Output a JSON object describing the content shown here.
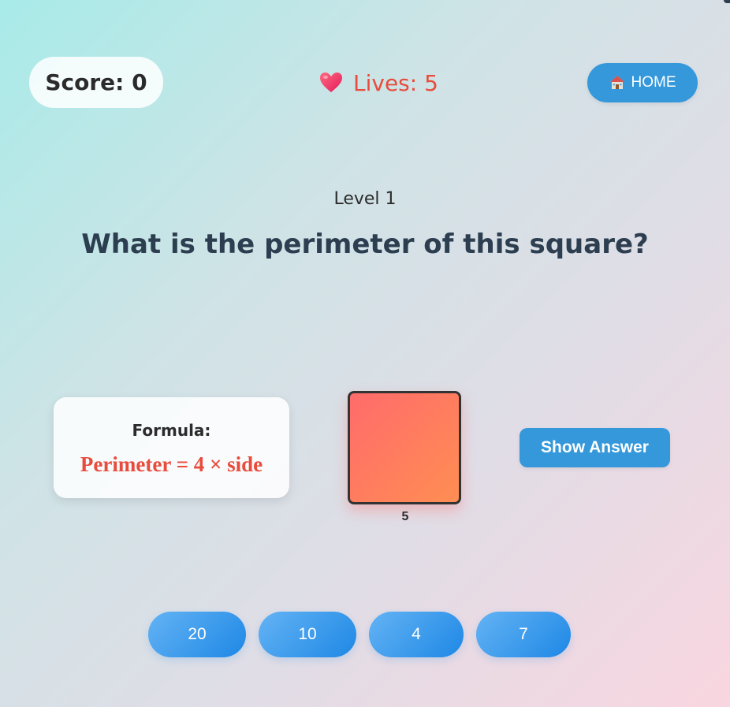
{
  "hud": {
    "score_text": "Score: 0",
    "lives_text": "Lives: 5",
    "home_label": "HOME"
  },
  "level_text": "Level 1",
  "question_text": "What is the perimeter of this square?",
  "formula": {
    "label": "Formula:",
    "text": "Perimeter = 4 × side"
  },
  "shape": {
    "type": "square",
    "side_label": "5",
    "fill_colors": [
      "#ff6b6b",
      "#ff8e53"
    ]
  },
  "show_answer_label": "Show Answer",
  "options": [
    "20",
    "10",
    "4",
    "7"
  ],
  "colors": {
    "accent": "#3498db",
    "lives": "#e74c3c",
    "formula": "#e74c3c",
    "question": "#2c3e50"
  },
  "icons": {
    "lives": "heart-icon",
    "home": "house-icon"
  }
}
